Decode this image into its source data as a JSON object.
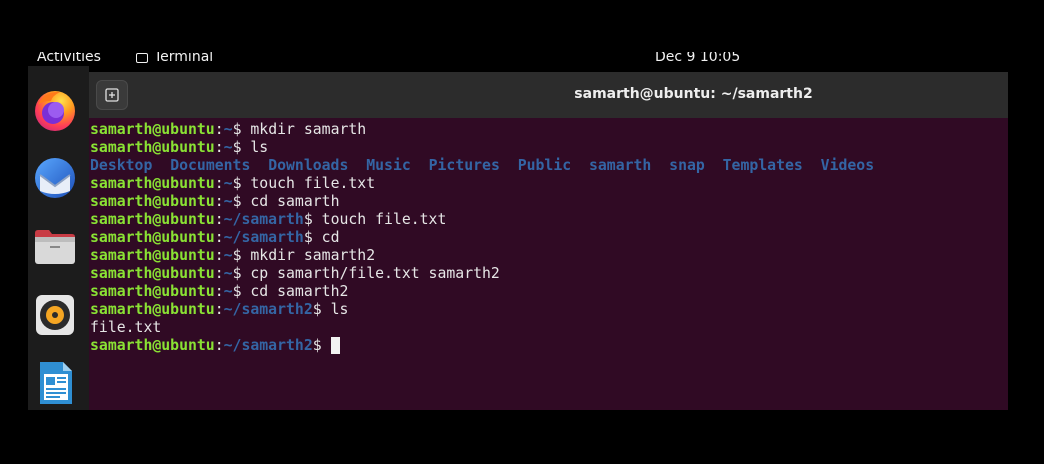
{
  "topbar": {
    "activities": "Activities",
    "app_name": "Terminal",
    "clock": "Dec 9  10:05"
  },
  "dock": {
    "items": [
      {
        "name": "Firefox",
        "icon": "firefox-icon"
      },
      {
        "name": "Thunderbird",
        "icon": "thunderbird-icon"
      },
      {
        "name": "Files",
        "icon": "files-icon"
      },
      {
        "name": "Rhythmbox",
        "icon": "rhythmbox-icon"
      },
      {
        "name": "LibreOffice Writer",
        "icon": "writer-icon"
      }
    ]
  },
  "window": {
    "title": "samarth@ubuntu: ~/samarth2",
    "new_tab_icon": "new-tab-icon"
  },
  "colors": {
    "background": "#300a24",
    "user": "#8ae234",
    "path": "#3465a4",
    "text": "#e6e6e6"
  },
  "terminal": {
    "lines": [
      {
        "type": "prompt",
        "user": "samarth@ubuntu",
        "path": "~",
        "command": "mkdir samarth"
      },
      {
        "type": "prompt",
        "user": "samarth@ubuntu",
        "path": "~",
        "command": "ls"
      },
      {
        "type": "dirs",
        "items": [
          "Desktop",
          "Documents",
          "Downloads",
          "Music",
          "Pictures",
          "Public",
          "samarth",
          "snap",
          "Templates",
          "Videos"
        ]
      },
      {
        "type": "prompt",
        "user": "samarth@ubuntu",
        "path": "~",
        "command": "touch file.txt"
      },
      {
        "type": "prompt",
        "user": "samarth@ubuntu",
        "path": "~",
        "command": "cd samarth"
      },
      {
        "type": "prompt",
        "user": "samarth@ubuntu",
        "path": "~/samarth",
        "command": "touch file.txt"
      },
      {
        "type": "prompt",
        "user": "samarth@ubuntu",
        "path": "~/samarth",
        "command": "cd"
      },
      {
        "type": "prompt",
        "user": "samarth@ubuntu",
        "path": "~",
        "command": "mkdir samarth2"
      },
      {
        "type": "prompt",
        "user": "samarth@ubuntu",
        "path": "~",
        "command": "cp samarth/file.txt samarth2"
      },
      {
        "type": "prompt",
        "user": "samarth@ubuntu",
        "path": "~",
        "command": "cd samarth2"
      },
      {
        "type": "prompt",
        "user": "samarth@ubuntu",
        "path": "~/samarth2",
        "command": "ls"
      },
      {
        "type": "output",
        "text": "file.txt"
      },
      {
        "type": "prompt",
        "user": "samarth@ubuntu",
        "path": "~/samarth2",
        "command": "",
        "cursor": true
      }
    ]
  }
}
